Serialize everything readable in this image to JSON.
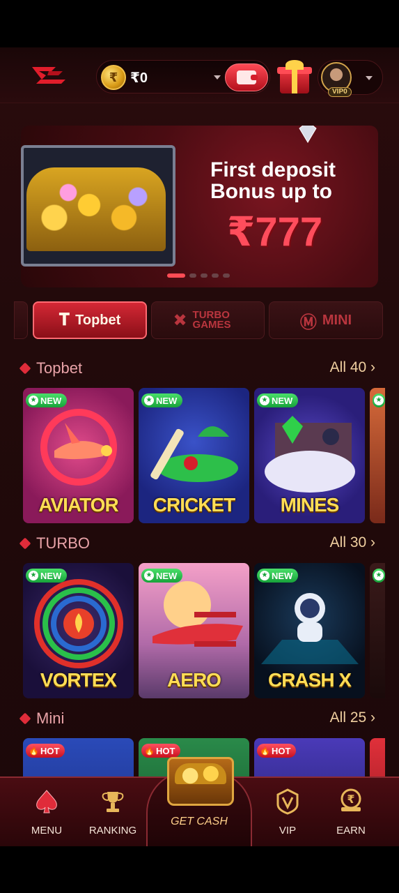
{
  "header": {
    "balance": "₹0",
    "coin_symbol": "₹",
    "vip_level": "VIP0"
  },
  "banner": {
    "title": "First deposit Bonus up to",
    "amount": "₹777",
    "slide_count": 5,
    "active_slide": 1
  },
  "tabs": [
    {
      "label": "Topbet",
      "icon": "topbet-icon",
      "active": true
    },
    {
      "label": "TURBO GAMES",
      "icon": "x-icon",
      "active": false
    },
    {
      "label": "MINI",
      "icon": "mini-icon",
      "active": false
    }
  ],
  "sections": [
    {
      "title": "Topbet",
      "all_label": "All 40",
      "games": [
        {
          "name": "AVIATOR",
          "badge": "NEW"
        },
        {
          "name": "CRICKET",
          "badge": "NEW"
        },
        {
          "name": "MINES",
          "badge": "NEW"
        }
      ]
    },
    {
      "title": "TURBO",
      "all_label": "All 30",
      "games": [
        {
          "name": "VORTEX",
          "badge": "NEW"
        },
        {
          "name": "AERO",
          "badge": "NEW"
        },
        {
          "name": "CRASH X",
          "badge": "NEW"
        }
      ]
    },
    {
      "title": "Mini",
      "all_label": "All 25",
      "games": [
        {
          "name": "",
          "badge": "HOT"
        },
        {
          "name": "",
          "badge": "HOT"
        },
        {
          "name": "",
          "badge": "HOT"
        }
      ]
    }
  ],
  "bottom_nav": [
    {
      "label": "MENU",
      "icon": "spade-icon"
    },
    {
      "label": "RANKING",
      "icon": "trophy-icon"
    },
    {
      "label": "GET CASH",
      "icon": "treasure-chest-icon"
    },
    {
      "label": "VIP",
      "icon": "vip-badge-icon"
    },
    {
      "label": "EARN",
      "icon": "rupee-coin-icon"
    }
  ],
  "colors": {
    "accent": "#e02c3a",
    "background": "#2a0b0d",
    "gold": "#ffdd55",
    "new_badge": "#17a23a"
  }
}
